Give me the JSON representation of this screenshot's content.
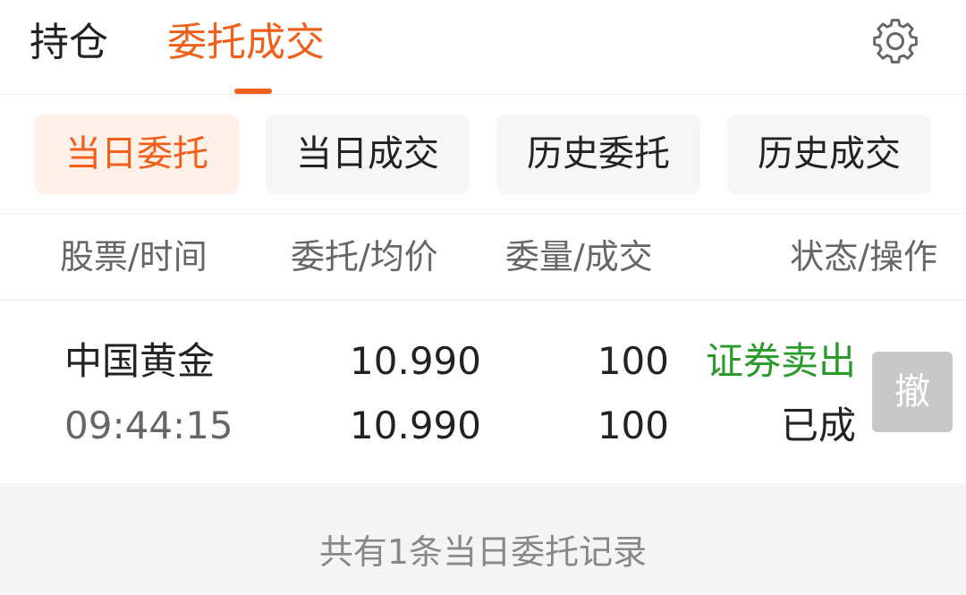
{
  "top_tabs": {
    "holdings": "持仓",
    "orders": "委托成交",
    "active_index": 1
  },
  "icons": {
    "settings": "gear-icon"
  },
  "colors": {
    "accent": "#f0601a",
    "sell": "#2a9a2a",
    "cancel_disabled": "#c8c8c8"
  },
  "filters": {
    "today_orders": "当日委托",
    "today_trades": "当日成交",
    "history_orders": "历史委托",
    "history_trades": "历史成交",
    "active_index": 0
  },
  "columns": {
    "stock_time": "股票/时间",
    "price_avg": "委托/均价",
    "qty_filled": "委量/成交",
    "status_action": "状态/操作"
  },
  "orders": [
    {
      "name": "中国黄金",
      "time": "09:44:15",
      "order_price": "10.990",
      "avg_price": "10.990",
      "order_qty": "100",
      "filled_qty": "100",
      "side": "证券卖出",
      "status": "已成",
      "cancel_label": "撤",
      "cancel_enabled": false
    }
  ],
  "footer": {
    "summary": "共有1条当日委托记录"
  }
}
